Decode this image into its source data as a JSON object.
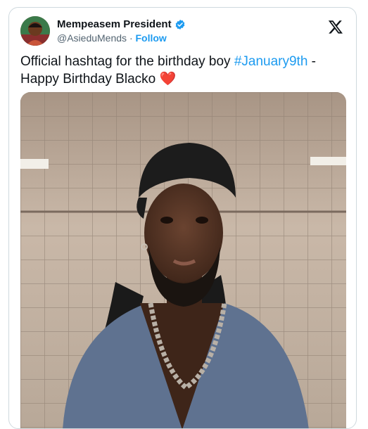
{
  "tweet": {
    "display_name": "Mempeasem President",
    "handle": "@AsieduMends",
    "separator": "·",
    "follow_label": "Follow",
    "text_before": "Official hashtag for the birthday boy ",
    "hashtag": "#January9th",
    "text_after": " - Happy Birthday Blacko ",
    "heart": "❤️"
  },
  "icons": {
    "verified": "verified-badge-icon",
    "brand": "x-logo-icon"
  },
  "colors": {
    "accent": "#1d9bf0",
    "text": "#0f1419",
    "muted": "#536471",
    "heart": "#e0245e"
  }
}
